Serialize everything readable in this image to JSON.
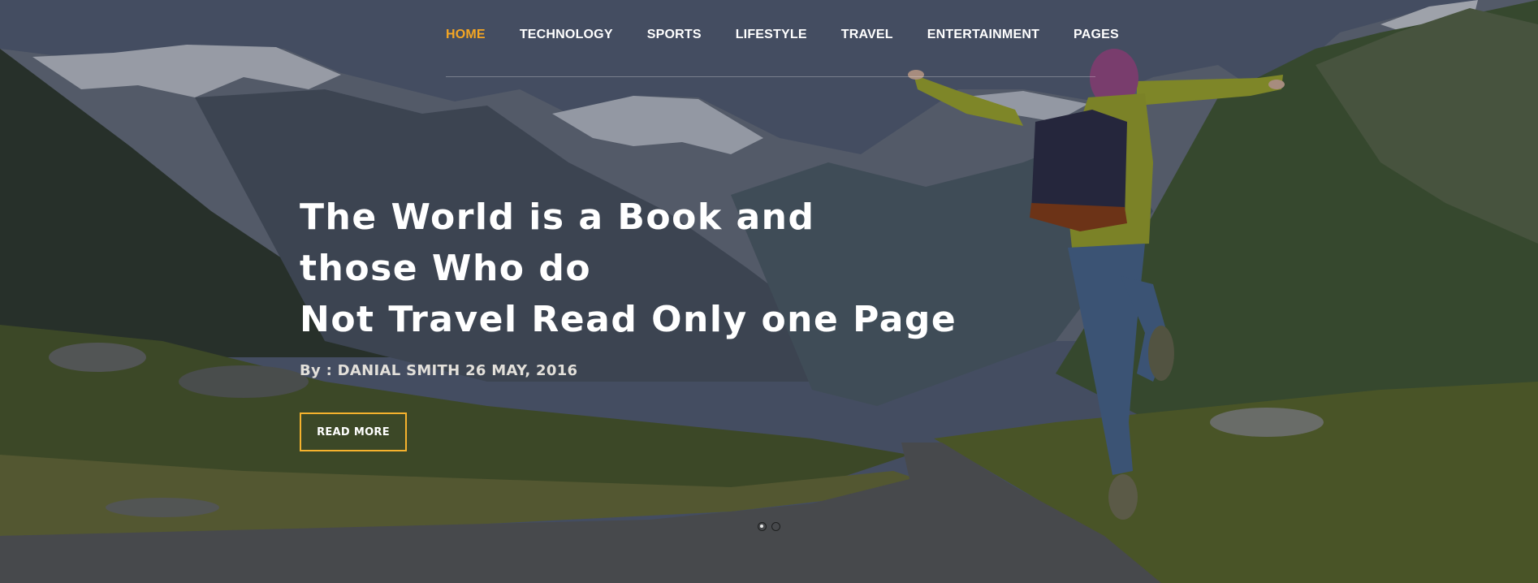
{
  "nav": {
    "items": [
      {
        "label": "HOME",
        "active": true
      },
      {
        "label": "TECHNOLOGY",
        "active": false
      },
      {
        "label": "SPORTS",
        "active": false
      },
      {
        "label": "LIFESTYLE",
        "active": false
      },
      {
        "label": "TRAVEL",
        "active": false
      },
      {
        "label": "ENTERTAINMENT",
        "active": false
      },
      {
        "label": "PAGES",
        "active": false
      }
    ]
  },
  "hero": {
    "headline_lines": [
      "The World is a Book and",
      "those Who do",
      "Not Travel Read Only one Page"
    ],
    "byline": "By : DANIAL SMITH 26 MAY, 2016",
    "cta_label": "READ MORE"
  },
  "slider": {
    "slide_count": 2,
    "active_index": 0
  },
  "colors": {
    "accent": "#f5a623",
    "button_border": "#f5b22d",
    "text": "#ffffff"
  }
}
